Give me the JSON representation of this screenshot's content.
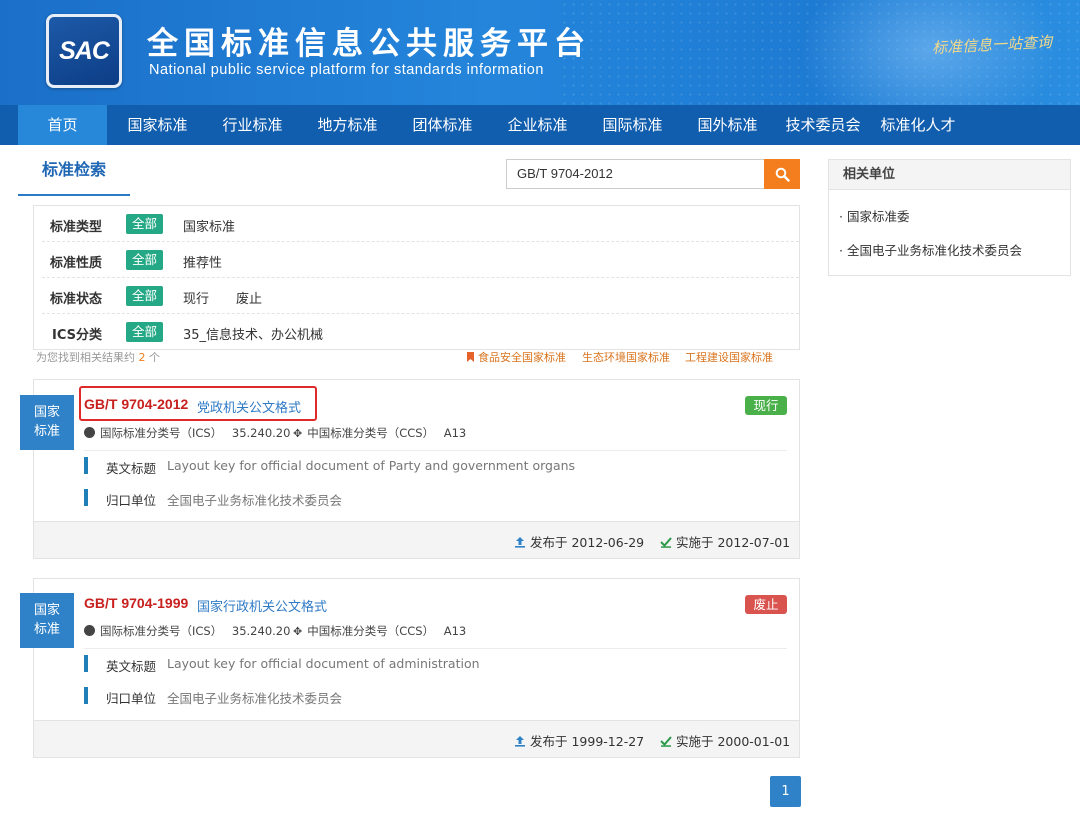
{
  "header": {
    "logo_text": "SAC",
    "title": "全国标准信息公共服务平台",
    "subtitle": "National public service platform  for standards information",
    "slogan": "标准信息一站查询"
  },
  "nav": {
    "items": [
      {
        "label": "首页",
        "active": true
      },
      {
        "label": "国家标准"
      },
      {
        "label": "行业标准"
      },
      {
        "label": "地方标准"
      },
      {
        "label": "团体标准"
      },
      {
        "label": "企业标准"
      },
      {
        "label": "国际标准"
      },
      {
        "label": "国外标准"
      },
      {
        "label": "技术委员会"
      },
      {
        "label": "标准化人才"
      }
    ]
  },
  "search": {
    "tab_label": "标准检索",
    "query": "GB/T 9704-2012",
    "button_icon": "search-icon"
  },
  "filters": [
    {
      "label": "标准类型",
      "all": "全部",
      "values": [
        "国家标准"
      ]
    },
    {
      "label": "标准性质",
      "all": "全部",
      "values": [
        "推荐性"
      ]
    },
    {
      "label": "标准状态",
      "all": "全部",
      "values": [
        "现行",
        "废止"
      ]
    },
    {
      "label": "ICS分类",
      "all": "全部",
      "values": [
        "35_信息技术、办公机械"
      ]
    }
  ],
  "result_summary": {
    "prefix": "为您找到相关结果约",
    "count": "2",
    "suffix": "个"
  },
  "quick_links": [
    "食品安全国家标准",
    "生态环境国家标准",
    "工程建设国家标准"
  ],
  "results": [
    {
      "badge": [
        "国家",
        "标准"
      ],
      "code": "GB/T 9704-2012",
      "name": "党政机关公文格式",
      "status": "现行",
      "status_color": "#4ab04a",
      "ics_label": "国际标准分类号（ICS）",
      "ics": "35.240.20",
      "ccs_label": "中国标准分类号（CCS）",
      "ccs": "A13",
      "en_label": "英文标题",
      "en_title": "Layout key for official document of Party and government organs",
      "unit_label": "归口单位",
      "unit": "全国电子业务标准化技术委员会",
      "publish": "发布于 2012-06-29",
      "implement": "实施于 2012-07-01",
      "highlighted": true
    },
    {
      "badge": [
        "国家",
        "标准"
      ],
      "code": "GB/T 9704-1999",
      "name": "国家行政机关公文格式",
      "status": "废止",
      "status_color": "#d9534f",
      "ics_label": "国际标准分类号（ICS）",
      "ics": "35.240.20",
      "ccs_label": "中国标准分类号（CCS）",
      "ccs": "A13",
      "en_label": "英文标题",
      "en_title": "Layout key for official document of administration",
      "unit_label": "归口单位",
      "unit": "全国电子业务标准化技术委员会",
      "publish": "发布于 1999-12-27",
      "implement": "实施于 2000-01-01",
      "highlighted": false
    }
  ],
  "sidebar": {
    "title": "相关单位",
    "items": [
      "国家标准委",
      "全国电子业务标准化技术委员会"
    ]
  },
  "pagination": {
    "current": "1"
  }
}
